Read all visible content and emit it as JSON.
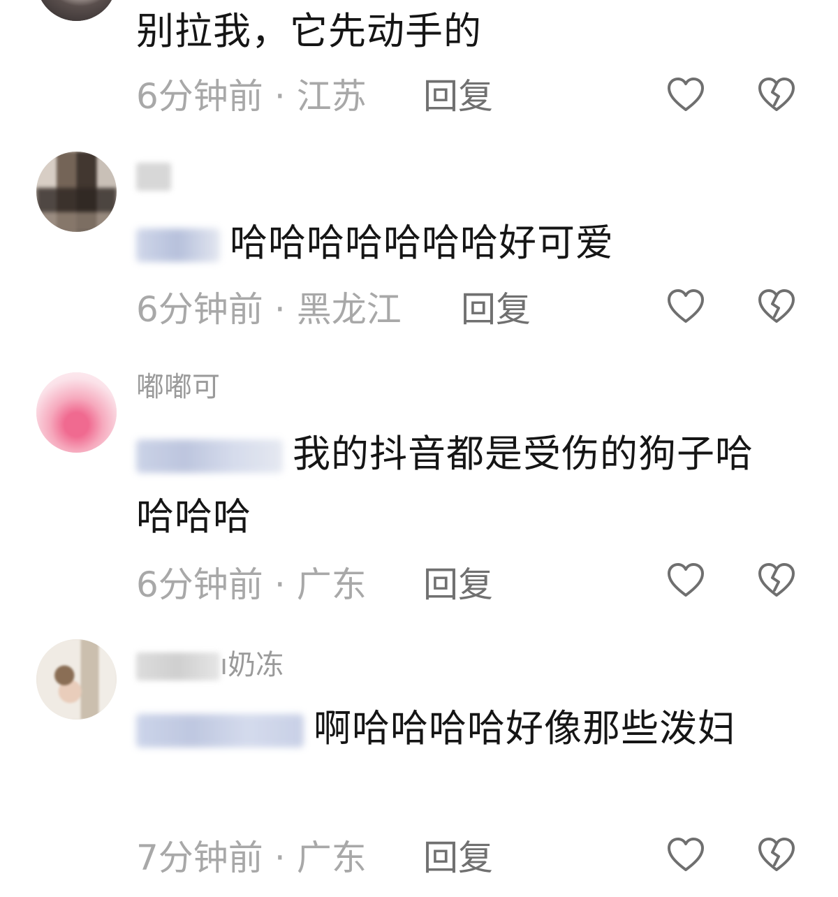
{
  "comments": [
    {
      "text": "别拉我，它先动手的",
      "time": "6分钟前",
      "dot": "·",
      "location": "江苏",
      "reply_label": "回复"
    },
    {
      "username": "",
      "text": "哈哈哈哈哈哈哈好可爱",
      "time": "6分钟前",
      "dot": "·",
      "location": "黑龙江",
      "reply_label": "回复"
    },
    {
      "username": "嘟嘟可",
      "text": "我的抖音都是受伤的狗子哈哈哈哈",
      "time": "6分钟前",
      "dot": "·",
      "location": "广东",
      "reply_label": "回复"
    },
    {
      "username": "ı奶冻",
      "text": "啊哈哈哈哈好像那些泼妇",
      "time": "7分钟前",
      "dot": "·",
      "location": "广东",
      "reply_label": "回复"
    }
  ],
  "icons": {
    "like": "heart-outline-icon",
    "dislike": "broken-heart-icon"
  },
  "colors": {
    "meta_text": "#a8a8a8",
    "reply_text": "#707070",
    "body_text": "#151515",
    "icon_stroke": "#6f6f6f"
  }
}
